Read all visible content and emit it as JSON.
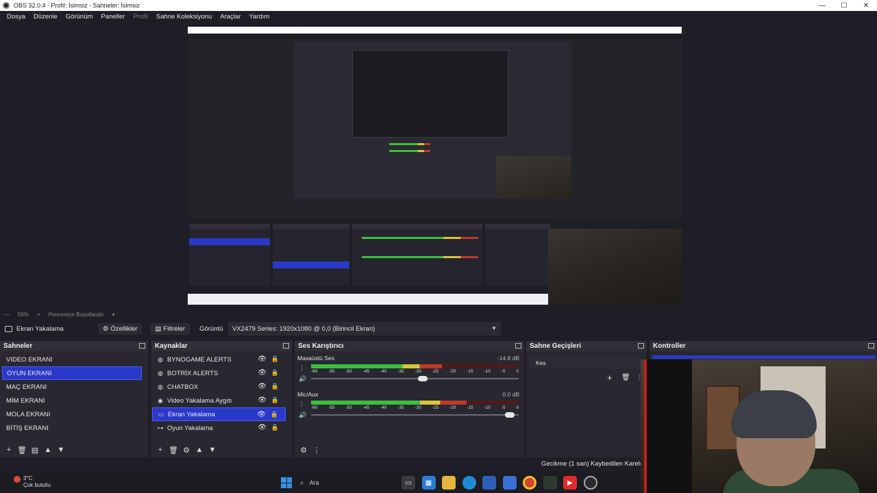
{
  "window": {
    "title": "OBS 32.0.4 - Profil: İsimsiz - Sahneler: İsimsiz"
  },
  "menu": [
    {
      "label": "Dosya",
      "enabled": true
    },
    {
      "label": "Düzenle",
      "enabled": true
    },
    {
      "label": "Görünüm",
      "enabled": true
    },
    {
      "label": "Paneller",
      "enabled": true
    },
    {
      "label": "Profil",
      "enabled": false
    },
    {
      "label": "Sahne Koleksiyonu",
      "enabled": true
    },
    {
      "label": "Araçlar",
      "enabled": true
    },
    {
      "label": "Yardım",
      "enabled": true
    }
  ],
  "zoom": {
    "value": "56%",
    "mode": "Pencereye Boyutlandır"
  },
  "source_toolbar": {
    "selected_source": "Ekran Yakalama",
    "properties_label": "Özellikler",
    "filters_label": "Filtreler",
    "display_label": "Görüntü",
    "display_value": "VX2479 Series: 1920x1080 @ 0,0 (Birincil Ekran)"
  },
  "scenes": {
    "title": "Sahneler",
    "items": [
      "VIDEO EKRANI",
      "OYUN EKRANI",
      "MAÇ EKRANI",
      "MİM EKRANI",
      "MOLA EKRANI",
      "BİTİŞ EKRANI"
    ],
    "selected_index": 1
  },
  "sources": {
    "title": "Kaynaklar",
    "items": [
      {
        "label": "BYNOGAME ALERTS",
        "icon": "globe-icon"
      },
      {
        "label": "BOTRİX ALERTS",
        "icon": "globe-icon"
      },
      {
        "label": "CHATBOX",
        "icon": "globe-icon"
      },
      {
        "label": "Video Yakalama Aygıtı",
        "icon": "camera-icon"
      },
      {
        "label": "Ekran Yakalama",
        "icon": "monitor-icon"
      },
      {
        "label": "Oyun Yakalama",
        "icon": "gamepad-icon"
      }
    ],
    "selected_index": 4
  },
  "mixer": {
    "title": "Ses Karıştırıcı",
    "channels": [
      {
        "name": "Masaüstü Ses",
        "db": "-14.8 dB",
        "level": 0.63,
        "volume": 0.56
      },
      {
        "name": "Mic/Aux",
        "db": "0.0 dB",
        "level": 0.75,
        "volume": 0.98
      }
    ],
    "ticks": [
      "-60",
      "-55",
      "-50",
      "-45",
      "-40",
      "-35",
      "-30",
      "-25",
      "-20",
      "-15",
      "-10",
      "-5",
      "0"
    ]
  },
  "transitions": {
    "title": "Sahne Geçişleri",
    "current": "Kes"
  },
  "controls": {
    "title": "Kontroller"
  },
  "status": {
    "delay": "Gecikme (1 san)",
    "dropped": "Kaybedilen Kareler"
  },
  "taskbar": {
    "weather_temp": "3°C",
    "weather_desc": "Çok bulutlu",
    "search_placeholder": "Ara"
  },
  "colors": {
    "accent": "#2b39c8",
    "background": "#1e1f26",
    "dock": "#272830"
  }
}
